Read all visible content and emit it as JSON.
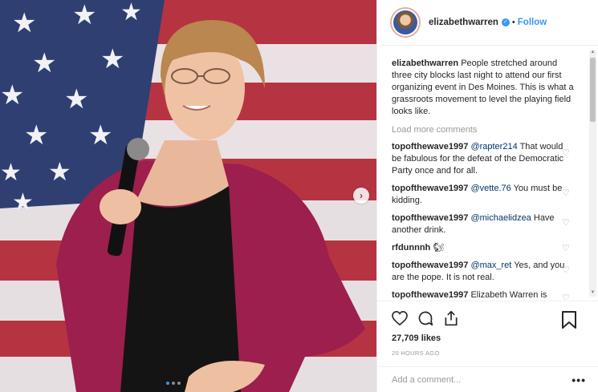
{
  "header": {
    "username": "elizabethwarren",
    "separator": "•",
    "follow_label": "Follow",
    "verified_icon": "verified-badge-icon"
  },
  "caption": {
    "username": "elizabethwarren",
    "text": "People stretched around three city blocks last night to attend our first organizing event in Des Moines. This is what a grassroots movement to level the playing field looks like."
  },
  "load_more_label": "Load more comments",
  "comments": [
    {
      "username": "topofthewave1997",
      "mention": "@rapter214",
      "text": "That would be fabulous for the defeat of the Democratic Party once and for all."
    },
    {
      "username": "topofthewave1997",
      "mention": "@vette.76",
      "text": "You must be kidding."
    },
    {
      "username": "topofthewave1997",
      "mention": "@michaelidzea",
      "text": "Have another drink."
    },
    {
      "username": "rfdunnnh",
      "mention": "",
      "text": "🐿"
    },
    {
      "username": "topofthewave1997",
      "mention": "@max_ret",
      "text": "Yes, and you are the pope. It is not real."
    },
    {
      "username": "topofthewave1997",
      "mention": "",
      "text": "Elizabeth Warren is made for you."
    }
  ],
  "likes": "27,709 likes",
  "timestamp": "20 HOURS AGO",
  "add_comment_placeholder": "Add a comment...",
  "more_label": "•••",
  "colors": {
    "accent": "#3897f0",
    "mention": "#003569",
    "muted": "#999999",
    "text": "#262626"
  }
}
